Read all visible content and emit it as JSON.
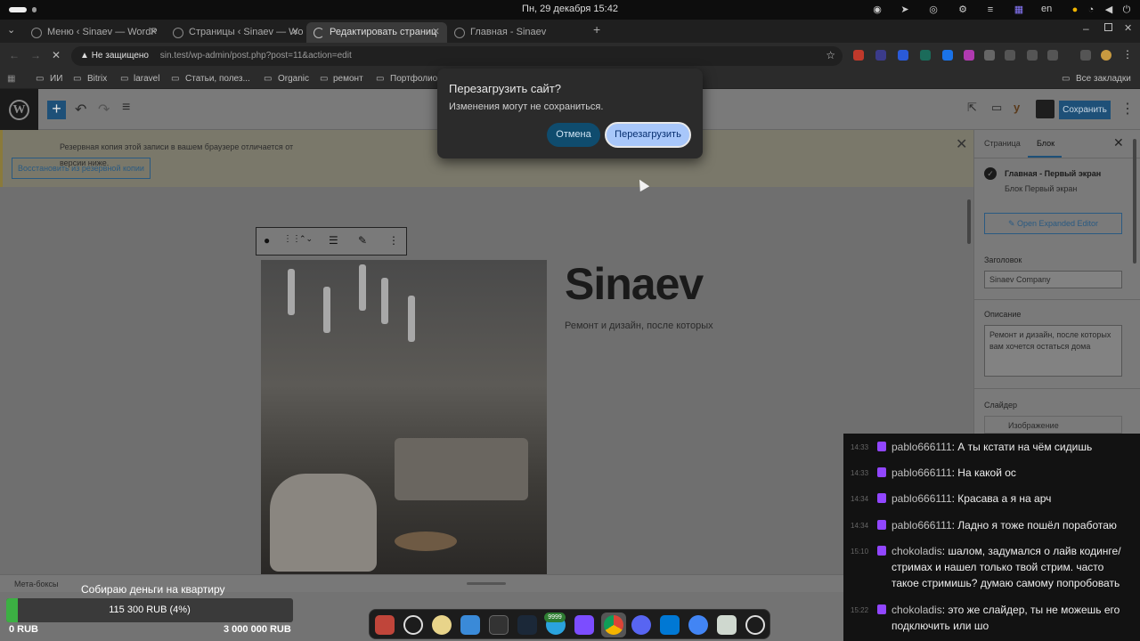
{
  "system": {
    "clock": "Пн, 29 декабря  15:42",
    "lang": "en"
  },
  "browser": {
    "tabs": [
      {
        "label": "Меню ‹ Sinaev — WordP",
        "active": false
      },
      {
        "label": "Страницы ‹ Sinaev — Wo",
        "active": false
      },
      {
        "label": "Редактировать страниц",
        "active": true
      },
      {
        "label": "Главная - Sinaev",
        "active": false
      }
    ],
    "security_label": "Не защищено",
    "url": "sin.test/wp-admin/post.php?post=11&action=edit",
    "bookmarks": [
      "ИИ",
      "Bitrix",
      "laravel",
      "Статьи, полез...",
      "Organic",
      "ремонт",
      "Портфолио"
    ],
    "all_bookmarks": "Все закладки"
  },
  "dialog": {
    "title": "Перезагрузить сайт?",
    "message": "Изменения могут не сохраниться.",
    "cancel_label": "Отмена",
    "reload_label": "Перезагрузить"
  },
  "editor": {
    "save_label": "Сохранить",
    "notice_text": "Резервная копия этой записи в вашем браузере отличается от версии ниже.",
    "restore_label": "Восстановить из резервной копии",
    "heading": "Sinaev",
    "subheading": "Ремонт и дизайн, после которых",
    "meta_boxes_label": "Мета-боксы"
  },
  "sidebar": {
    "tab_page": "Страница",
    "tab_block": "Блок",
    "block_title": "Главная - Первый экран",
    "block_subtitle": "Блок Первый экран",
    "expand_button": "Open Expanded Editor",
    "field_heading_label": "Заголовок",
    "field_heading_value": "Sinaev Company",
    "field_description_label": "Описание",
    "field_description_value": "Ремонт и дизайн, после которых вам хочется остаться дома",
    "field_slider_label": "Слайдер",
    "field_slider_col": "Изображение"
  },
  "chat": [
    {
      "time": "14:33",
      "user": "pablo666111",
      "text": "А ты кстати на чём сидишь"
    },
    {
      "time": "14:33",
      "user": "pablo666111",
      "text": "На какой ос"
    },
    {
      "time": "14:34",
      "user": "pablo666111",
      "text": "Красава а я на арч"
    },
    {
      "time": "14:34",
      "user": "pablo666111",
      "text": "Ладно я тоже пошёл поработаю"
    },
    {
      "time": "15:10",
      "user": "chokoladis",
      "text": "шалом, задумался о лайв кодинге/ стримах и нашел только твой стрим. часто такое стримишь? думаю самому попробовать"
    },
    {
      "time": "15:22",
      "user": "chokoladis",
      "text": "это же слайдер, ты не можешь его подключить или шо"
    }
  ],
  "donation": {
    "title": "Собираю деньги на квартиру",
    "progress_text": "115 300 RUB (4%)",
    "progress_fraction": 0.04,
    "min_label": "0 RUB",
    "max_label": "3 000 000 RUB"
  },
  "dock": {
    "badge": "9999",
    "apps": [
      "files-icon",
      "browser-alt-icon",
      "media-icon",
      "store-icon",
      "terminal-icon",
      "steam-icon",
      "telegram-icon",
      "obsidian-icon",
      "chrome-icon",
      "discord-icon",
      "vscode-icon",
      "chromium-icon",
      "trash-icon",
      "apps-grid-icon"
    ]
  }
}
